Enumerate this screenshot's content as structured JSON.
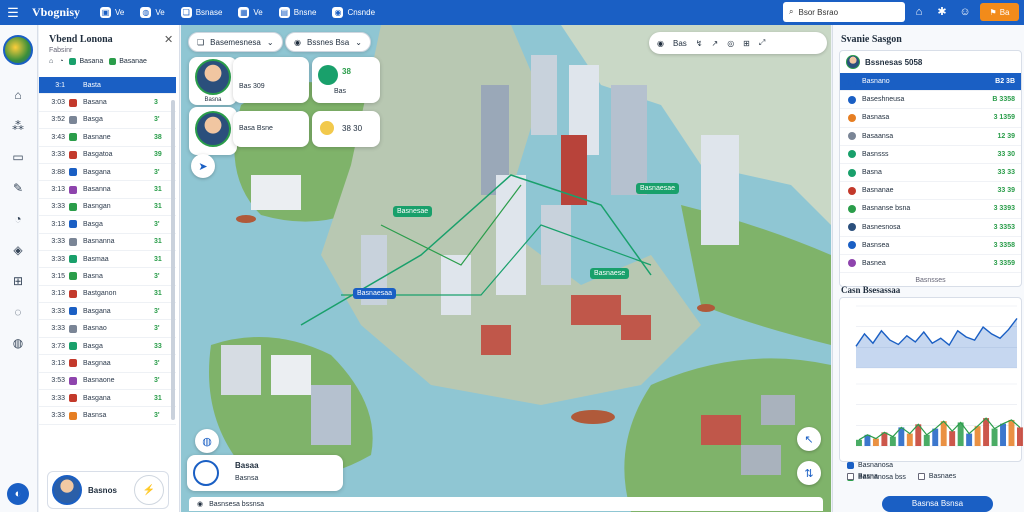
{
  "app": {
    "title": "Vbognisy"
  },
  "topbar": {
    "nav": [
      {
        "icon": "dashboard-icon",
        "glyph": "▣",
        "label": "Ve"
      },
      {
        "icon": "globe-icon",
        "glyph": "◍",
        "label": "Ve"
      },
      {
        "icon": "layers-icon",
        "glyph": "❏",
        "label": "Bsnase"
      },
      {
        "icon": "grid-icon",
        "glyph": "▦",
        "label": "Ve"
      },
      {
        "icon": "briefcase-icon",
        "glyph": "▤",
        "label": "Bnsne"
      },
      {
        "icon": "settings-icon",
        "glyph": "◉",
        "label": "Cnsnde"
      }
    ],
    "search_value": "Bsor Bsrao",
    "action_label": "Ba"
  },
  "left_panel": {
    "title": "Vbend Lonona",
    "subtitle": "Fabsinr",
    "filters": [
      {
        "label": "Basana",
        "color": "#19a06b"
      },
      {
        "label": "Basanae",
        "color": "#2a9d4a"
      }
    ],
    "rows": [
      {
        "time": "3:1",
        "label": "Basta",
        "value": "",
        "color": "#1a5fc4",
        "selected": true
      },
      {
        "time": "3:03",
        "label": "Basana",
        "value": "3",
        "color": "#c3392b",
        "selected": false
      },
      {
        "time": "3:52",
        "label": "Basga",
        "value": "3'",
        "color": "#7a8596",
        "selected": false
      },
      {
        "time": "3:43",
        "label": "Basnane",
        "value": "38",
        "color": "#2a9d4a",
        "selected": false
      },
      {
        "time": "3:33",
        "label": "Basgatoa",
        "value": "39",
        "color": "#c3392b",
        "selected": false
      },
      {
        "time": "3:88",
        "label": "Basgana",
        "value": "3'",
        "color": "#1a5fc4",
        "selected": false
      },
      {
        "time": "3:13",
        "label": "Basanna",
        "value": "31",
        "color": "#8e44ad",
        "selected": false
      },
      {
        "time": "3:33",
        "label": "Basngan",
        "value": "31",
        "color": "#2a9d4a",
        "selected": false
      },
      {
        "time": "3:13",
        "label": "Basga",
        "value": "3'",
        "color": "#1a5fc4",
        "selected": false
      },
      {
        "time": "3:33",
        "label": "Basnanna",
        "value": "31",
        "color": "#7a8596",
        "selected": false
      },
      {
        "time": "3:33",
        "label": "Basmaa",
        "value": "31",
        "color": "#19a06b",
        "selected": false
      },
      {
        "time": "3:15",
        "label": "Basna",
        "value": "3'",
        "color": "#2a9d4a",
        "selected": false
      },
      {
        "time": "3:13",
        "label": "Bastganon",
        "value": "31",
        "color": "#c3392b",
        "selected": false
      },
      {
        "time": "3:33",
        "label": "Basgana",
        "value": "3'",
        "color": "#1a5fc4",
        "selected": false
      },
      {
        "time": "3:33",
        "label": "Basnao",
        "value": "3'",
        "color": "#7a8596",
        "selected": false
      },
      {
        "time": "3:73",
        "label": "Basga",
        "value": "33",
        "color": "#19a06b",
        "selected": false
      },
      {
        "time": "3:13",
        "label": "Basgnaa",
        "value": "3'",
        "color": "#c3392b",
        "selected": false
      },
      {
        "time": "3:53",
        "label": "Basnaone",
        "value": "3'",
        "color": "#8e44ad",
        "selected": false
      },
      {
        "time": "3:33",
        "label": "Basgana",
        "value": "31",
        "color": "#c3392b",
        "selected": false
      },
      {
        "time": "3:33",
        "label": "Basnsa",
        "value": "3'",
        "color": "#e67e22",
        "selected": false
      }
    ],
    "profile": {
      "name": "Basnos",
      "badge": "⚡"
    }
  },
  "map": {
    "pill1": "Basemesnesa",
    "pill2": "Bssnes Bsa",
    "card1": {
      "name": "Basna",
      "value": "Bas 309"
    },
    "card1_stat": {
      "value": "38",
      "label": "Bas"
    },
    "card2": {
      "name": "Basa Bsne",
      "value": ""
    },
    "card2_stat": {
      "value": "38 30"
    },
    "labels": [
      "Basnesae",
      "Basnaesae",
      "Basnaese",
      "Basnaesaa"
    ],
    "toolbar": [
      "Bas"
    ],
    "bottom_card": {
      "title": "Basaa",
      "sub": "Basnsa"
    },
    "bottom_bar": "Basnsesa bssnsa"
  },
  "right_panel": {
    "title": "Svanie Sasgon",
    "card_head": "Bssnesas 5058",
    "rows": [
      {
        "label": "Basnano",
        "value": "B2 3B",
        "color": "#1a5fc4",
        "selected": true
      },
      {
        "label": "Baseshneusa",
        "value": "B 3358",
        "color": "#1a5fc4",
        "selected": false
      },
      {
        "label": "Basnasa",
        "value": "3 1359",
        "color": "#e67e22",
        "selected": false
      },
      {
        "label": "Basaansa",
        "value": "12 39",
        "color": "#7a8596",
        "selected": false
      },
      {
        "label": "Basnsss",
        "value": "33 30",
        "color": "#19a06b",
        "selected": false
      },
      {
        "label": "Basna",
        "value": "33 33",
        "color": "#19a06b",
        "selected": false
      },
      {
        "label": "Basnanae",
        "value": "33 39",
        "color": "#c3392b",
        "selected": false
      },
      {
        "label": "Basnanse bsna",
        "value": "3 3393",
        "color": "#2a9d4a",
        "selected": false
      },
      {
        "label": "Basnesnosa",
        "value": "3 3353",
        "color": "#2b4f7c",
        "selected": false
      },
      {
        "label": "Basnsea",
        "value": "3 3358",
        "color": "#1a5fc4",
        "selected": false
      },
      {
        "label": "Basnea",
        "value": "3 3359",
        "color": "#8e44ad",
        "selected": false
      }
    ],
    "card_footer": "Basnsses",
    "chart_title": "Casn Bsesassaa",
    "legend": [
      {
        "label": "Basnanosa",
        "color": "#1a5fc4"
      },
      {
        "label": "Basnanosa bss",
        "color": "#2a9d4a"
      }
    ],
    "checks": [
      "Basna",
      "Basnaes"
    ],
    "button_label": "Basnsa Bsnsa"
  },
  "chart_data": {
    "type": "area",
    "series": [
      {
        "values": [
          35,
          55,
          40,
          60,
          45,
          38,
          52,
          42,
          58,
          40,
          48,
          37,
          60,
          50,
          45,
          66,
          55,
          48,
          62,
          80
        ]
      },
      {
        "values": [
          10,
          18,
          12,
          22,
          15,
          30,
          20,
          35,
          18,
          28,
          40,
          24,
          38,
          20,
          32,
          45,
          28,
          36,
          42,
          30
        ]
      }
    ],
    "ylim": [
      0,
      100
    ]
  }
}
